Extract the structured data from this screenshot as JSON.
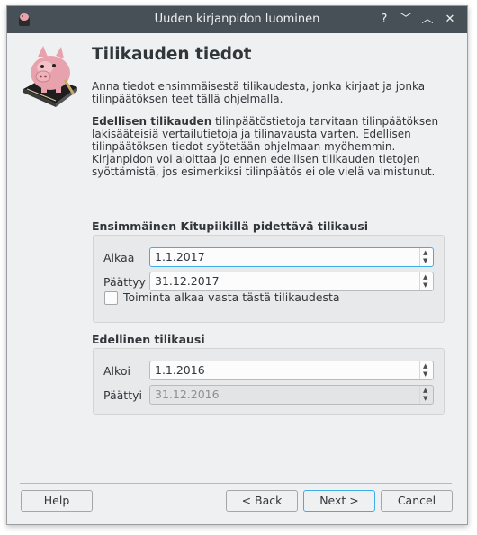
{
  "window": {
    "title": "Uuden kirjanpidon luominen",
    "controls": {
      "help": "?",
      "minimize": "﹀",
      "maximize": "︿",
      "close": "✕"
    }
  },
  "page": {
    "heading": "Tilikauden tiedot",
    "intro": "Anna tiedot ensimmäisestä tilikaudesta, jonka kirjaat ja jonka tilinpäätöksen teet tällä ohjelmalla.",
    "previous_bold": "Edellisen tilikauden",
    "previous_text": " tilinpäätöstietoja tarvitaan tilinpäätöksen lakisääteisiä vertailutietoja ja tilinavausta varten. Edellisen tilinpäätöksen tiedot syötetään ohjelmaan myöhemmin. Kirjanpidon voi aloittaa jo ennen edellisen tilikauden tietojen syöttämistä, jos esimerkiksi tilinpäätös ei ole vielä valmistunut."
  },
  "first_period": {
    "label": "Ensimmäinen Kitupiikillä pidettävä tilikausi",
    "start_label": "Alkaa",
    "start_value": "1.1.2017",
    "end_label": "Päättyy",
    "end_value": "31.12.2017",
    "checkbox_label": "Toiminta alkaa vasta tästä tilikaudesta"
  },
  "previous_period": {
    "label": "Edellinen tilikausi",
    "start_label": "Alkoi",
    "start_value": "1.1.2016",
    "end_label": "Päättyi",
    "end_value": "31.12.2016"
  },
  "buttons": {
    "help": "Help",
    "back": "< Back",
    "next": "Next >",
    "cancel": "Cancel"
  },
  "colors": {
    "titlebar": "#475057",
    "focus": "#3daee9",
    "background": "#eff0f1"
  }
}
